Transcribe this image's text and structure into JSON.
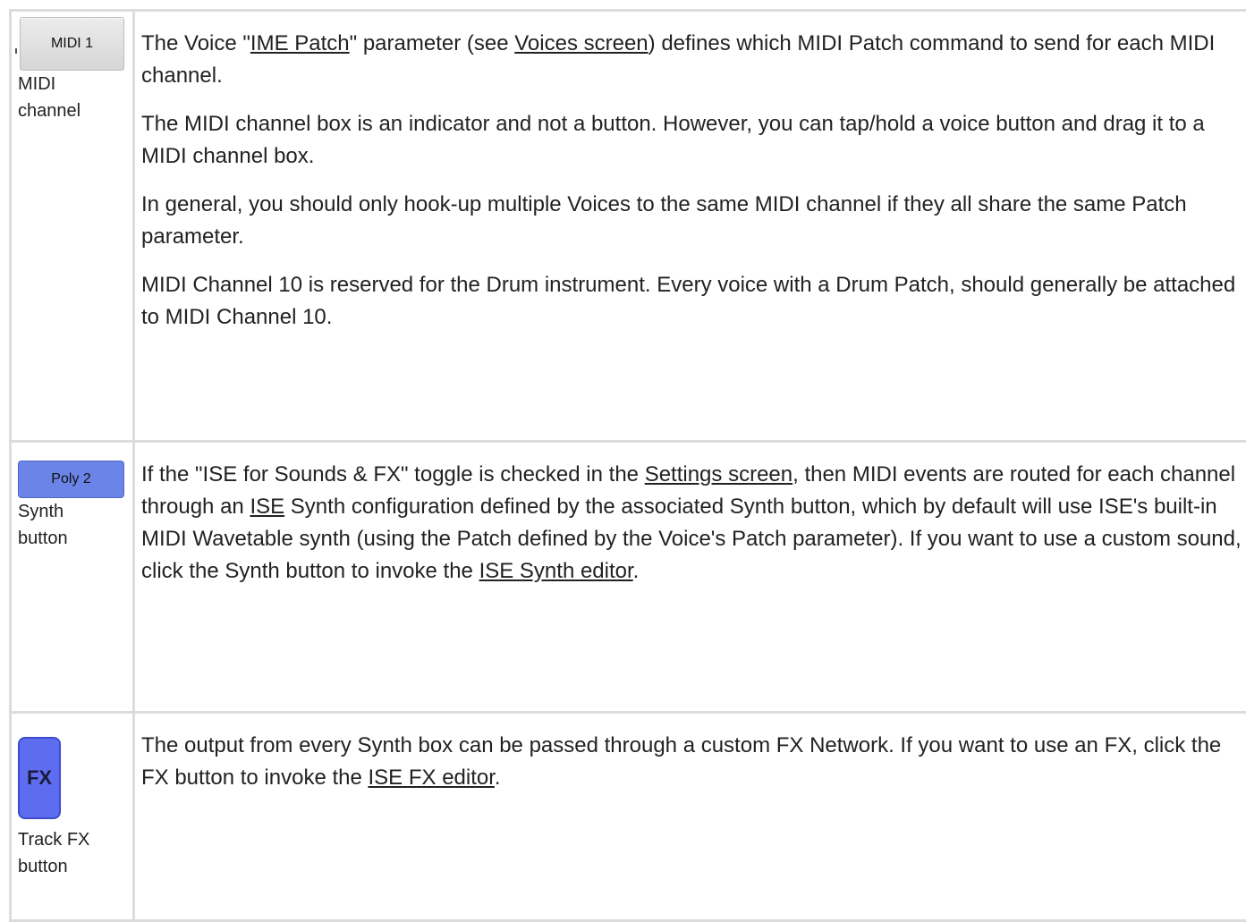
{
  "rows": [
    {
      "widget_label": "MIDI 1",
      "caption_line1": "MIDI",
      "caption_line2": "channel",
      "paragraphs": [
        {
          "t1": "The Voice \"",
          "link1": "IME Patch",
          "t2": "\" parameter (see ",
          "link2": "Voices screen",
          "t3": ") defines which MIDI Patch command to send for each MIDI channel."
        },
        {
          "text": "The MIDI channel box is an indicator and not a button. However, you can tap/hold a voice button and drag it to a MIDI channel box."
        },
        {
          "text": "In general, you should only hook-up multiple Voices to the same MIDI channel if they all share the same Patch parameter."
        },
        {
          "text": "MIDI Channel 10 is reserved for the Drum instrument. Every voice with a Drum Patch, should generally be attached to MIDI Channel 10."
        }
      ]
    },
    {
      "widget_label": "Poly 2",
      "caption_line1": "Synth",
      "caption_line2": "button",
      "paragraph": {
        "t1": "If the \"ISE for Sounds & FX\" toggle is checked in the ",
        "link1": "Settings screen",
        "t2": ", then MIDI events are routed for each channel through an ",
        "link2": "ISE",
        "t3": " Synth configuration defined by the associated Synth button, which by default will use ISE's built-in MIDI Wavetable synth (using the Patch defined by the Voice's Patch parameter). If you want to use a custom sound, click the Synth button to invoke the ",
        "link3": "ISE Synth editor",
        "t4": "."
      }
    },
    {
      "widget_label": "FX",
      "caption_line1": "Track FX",
      "caption_line2": "button",
      "paragraph": {
        "t1": "The output from every Synth box can be passed through a custom FX Network. If you want to use an FX, click the FX button to invoke the ",
        "link1": "ISE FX editor",
        "t2": "."
      }
    }
  ]
}
